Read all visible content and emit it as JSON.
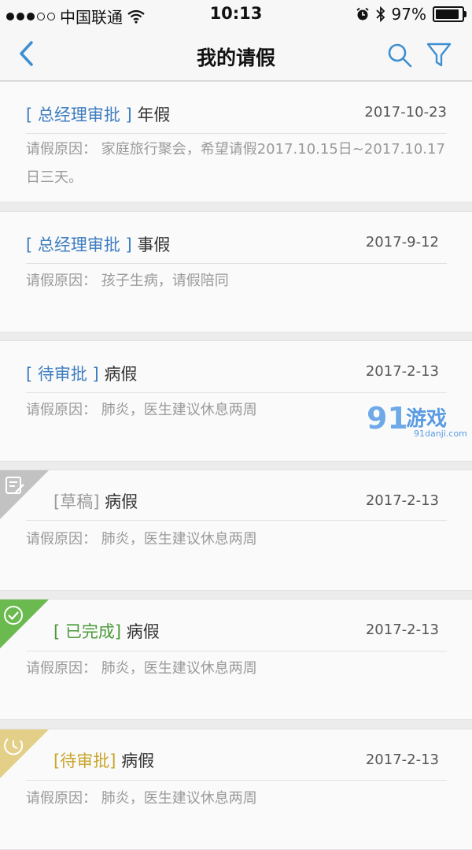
{
  "status_bar": {
    "carrier": "中国联通",
    "time": "10:13",
    "battery": "97%"
  },
  "nav": {
    "title": "我的请假",
    "icons": [
      "back-chevron-icon",
      "search-icon",
      "filter-icon"
    ],
    "accent": "#3d8fd1"
  },
  "leaves": [
    {
      "status": "[ 总经理审批 ]",
      "type": "年假",
      "date": "2017-10-23",
      "reason_label": "请假原因：",
      "reason": "家庭旅行聚会，希望请假2017.10.15日~2017.10.17日三天。",
      "status_color": "#3d7dc1"
    },
    {
      "status": "[ 总经理审批 ]",
      "type": "事假",
      "date": "2017-9-12",
      "reason_label": "请假原因：",
      "reason": "孩子生病，请假陪同",
      "status_color": "#3d7dc1"
    },
    {
      "status": "[ 待审批 ]",
      "type": "病假",
      "date": "2017-2-13",
      "reason_label": "请假原因：",
      "reason": "肺炎，医生建议休息两周",
      "status_color": "#3d7dc1"
    },
    {
      "status": "[草稿]",
      "type": "病假",
      "date": "2017-2-13",
      "reason_label": "请假原因：",
      "reason": "肺炎，医生建议休息两周",
      "status_color": "#9a9a9a",
      "corner_icon": "draft-edit-icon"
    },
    {
      "status": "[ 已完成]",
      "type": "病假",
      "date": "2017-2-13",
      "reason_label": "请假原因：",
      "reason": "肺炎，医生建议休息两周",
      "status_color": "#4a9a3a",
      "corner_icon": "completed-check-icon"
    },
    {
      "status": "[待审批]",
      "type": "病假",
      "date": "2017-2-13",
      "reason_label": "请假原因：",
      "reason": "肺炎，医生建议休息两周",
      "status_color": "#c8a52c",
      "corner_icon": "pending-clock-icon"
    }
  ],
  "watermark": {
    "logo": "91游戏",
    "url": "91danji.com"
  }
}
